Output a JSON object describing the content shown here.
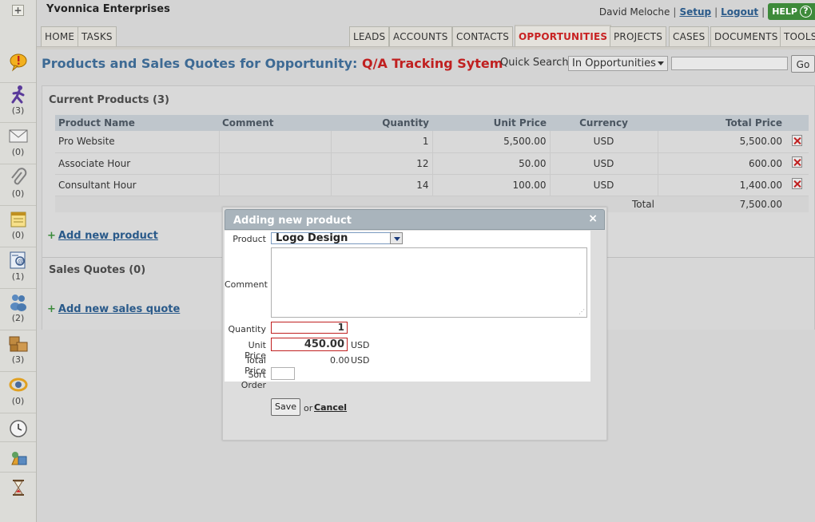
{
  "header": {
    "brand": "Yvonnica Enterprises",
    "user": "David Meloche",
    "setup": "Setup",
    "logout": "Logout",
    "help": "HELP",
    "help_icon": "?"
  },
  "tabs": {
    "home": "HOME",
    "tasks": "TASKS",
    "leads": "LEADS",
    "accounts": "ACCOUNTS",
    "contacts": "CONTACTS",
    "opportunities": "OPPORTUNITIES",
    "projects": "PROJECTS",
    "cases": "CASES",
    "documents": "DOCUMENTS",
    "tools": "TOOLS"
  },
  "sidebar": {
    "plus": "+",
    "items": [
      {
        "icon": "speech-bubble-alert-icon",
        "count": ""
      },
      {
        "icon": "running-person-icon",
        "count": "(3)"
      },
      {
        "icon": "envelope-icon",
        "count": "(0)"
      },
      {
        "icon": "paperclip-icon",
        "count": "(0)"
      },
      {
        "icon": "notepad-icon",
        "count": "(0)"
      },
      {
        "icon": "contact-card-icon",
        "count": "(1)"
      },
      {
        "icon": "people-icon",
        "count": "(2)"
      },
      {
        "icon": "boxes-icon",
        "count": "(3)"
      },
      {
        "icon": "target-ring-icon",
        "count": "(0)"
      },
      {
        "icon": "clock-icon",
        "count": ""
      },
      {
        "icon": "shapes-icon",
        "count": ""
      },
      {
        "icon": "hourglass-icon",
        "count": ""
      }
    ]
  },
  "page": {
    "title_prefix": "Products and Sales Quotes for Opportunity:",
    "opportunity_name": "Q/A Tracking Sytem",
    "quick_search_label": "Quick Search",
    "quick_search_scope": "In Opportunities",
    "go": "Go"
  },
  "products": {
    "title": "Current Products (3)",
    "columns": {
      "name": "Product Name",
      "comment": "Comment",
      "quantity": "Quantity",
      "unit_price": "Unit Price",
      "currency": "Currency",
      "total_price": "Total Price"
    },
    "rows": [
      {
        "name": "Pro Website",
        "comment": "",
        "quantity": "1",
        "unit_price": "5,500.00",
        "currency": "USD",
        "total": "5,500.00"
      },
      {
        "name": "Associate Hour",
        "comment": "",
        "quantity": "12",
        "unit_price": "50.00",
        "currency": "USD",
        "total": "600.00"
      },
      {
        "name": "Consultant Hour",
        "comment": "",
        "quantity": "14",
        "unit_price": "100.00",
        "currency": "USD",
        "total": "1,400.00"
      }
    ],
    "total_label": "Total",
    "total_value": "7,500.00",
    "add_link": "Add new product",
    "plus": "+"
  },
  "quotes": {
    "title": "Sales Quotes (0)",
    "add_link": "Add new sales quote",
    "plus": "+"
  },
  "modal": {
    "title": "Adding new product",
    "close": "×",
    "product_label": "Product",
    "product_value": "Logo Design",
    "comment_label": "Comment",
    "comment_value": "",
    "quantity_label": "Quantity",
    "quantity_value": "1",
    "unit_price_label": "Unit Price",
    "unit_price_value": "450.00",
    "currency": "USD",
    "total_price_label": "Total Price",
    "total_price_value": "0.00",
    "sort_order_label": "Sort Order",
    "save": "Save",
    "or": "or",
    "cancel": "Cancel"
  }
}
